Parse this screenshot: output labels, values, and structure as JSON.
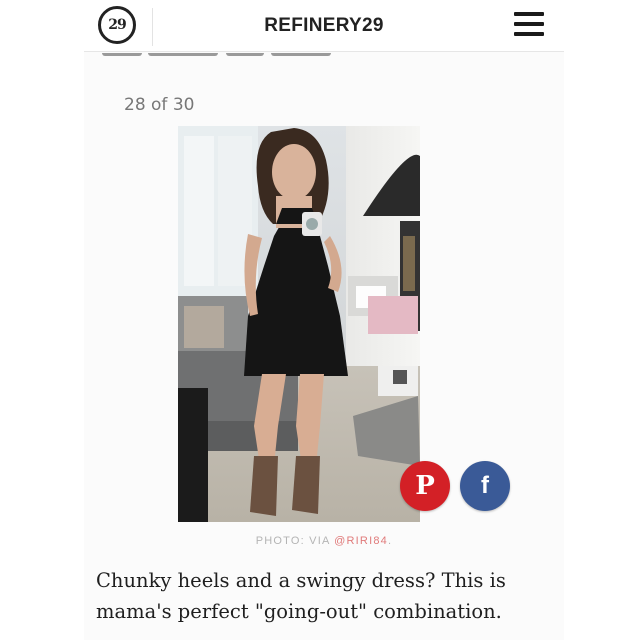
{
  "header": {
    "logo_text": "29",
    "brand": "REFINERY29",
    "menu_icon": "hamburger-menu-icon"
  },
  "slideshow": {
    "counter": "28 of 30",
    "photo_credit_prefix": "PHOTO: VIA ",
    "photo_credit_handle": "@RIRI84",
    "photo_credit_suffix": ".",
    "caption": "Chunky heels and a swingy dress? This is mama's perfect \"going-out\" combination."
  },
  "share": {
    "pinterest_glyph": "P",
    "facebook_glyph": "f",
    "pinterest_color": "#d32026",
    "facebook_color": "#3a5a97"
  }
}
